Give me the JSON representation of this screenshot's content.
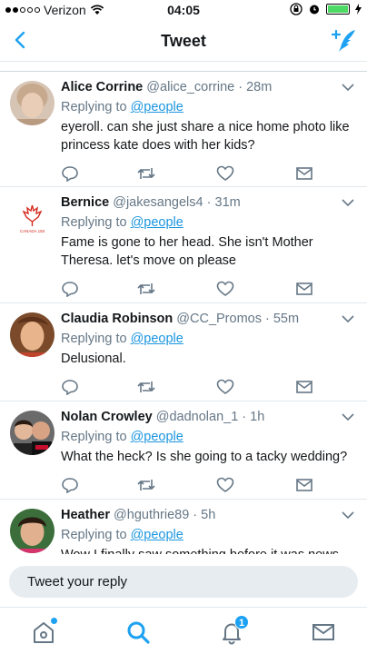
{
  "status_bar": {
    "carrier": "Verizon",
    "time": "04:05"
  },
  "nav": {
    "title": "Tweet"
  },
  "colors": {
    "accent": "#1da1f2",
    "link": "#1b95e0",
    "secondary_text": "#657786",
    "battery": "#4cd964"
  },
  "tweets": [
    {
      "name": "Alice Corrine",
      "handle": "@alice_corrine",
      "time": "28m",
      "replying_prefix": "Replying to",
      "replying_to": "@people",
      "text": "eyeroll. can she just share a nice home photo like princess kate does with her kids?"
    },
    {
      "name": "Bernice",
      "handle": "@jakesangels4",
      "time": "31m",
      "replying_prefix": "Replying to",
      "replying_to": "@people",
      "text": "Fame is gone to her head. She isn't Mother Theresa. let's move on please",
      "avatar_label": "CANADA 150"
    },
    {
      "name": "Claudia Robinson",
      "handle": "@CC_Promos",
      "time": "55m",
      "replying_prefix": "Replying to",
      "replying_to": "@people",
      "text": "Delusional."
    },
    {
      "name": "Nolan Crowley",
      "handle": "@dadnolan_1",
      "time": "1h",
      "replying_prefix": "Replying to",
      "replying_to": "@people",
      "text": "What the heck? Is she going to a tacky wedding?"
    },
    {
      "name": "Heather",
      "handle": "@hguthrie89",
      "time": "5h",
      "replying_prefix": "Replying to",
      "replying_to": "@people",
      "text": "Wow I finally saw something before it was news"
    }
  ],
  "reply": {
    "placeholder": "Tweet your reply"
  },
  "tabs": {
    "notification_count": "1",
    "icons": [
      "home-icon",
      "search-icon",
      "notifications-icon",
      "messages-icon"
    ]
  }
}
